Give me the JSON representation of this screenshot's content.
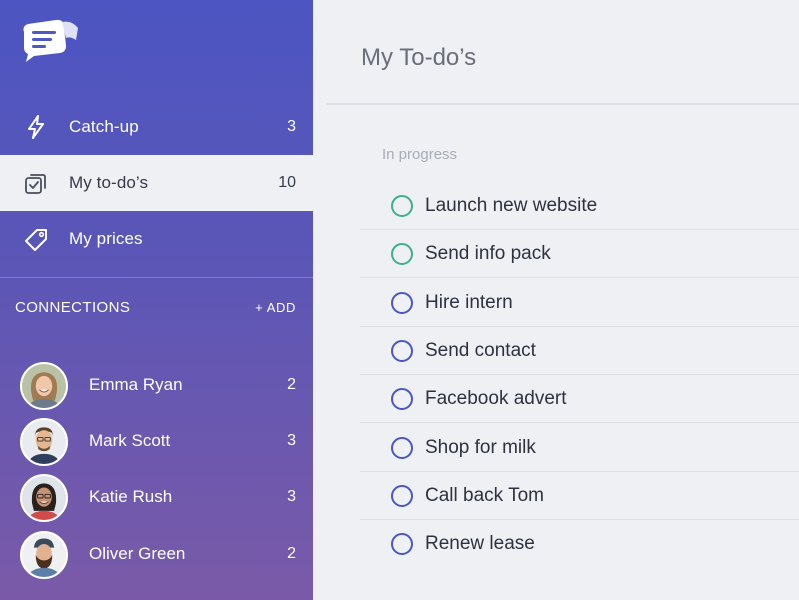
{
  "sidebar": {
    "nav": [
      {
        "label": "Catch-up",
        "count": "3",
        "icon": "lightning-icon"
      },
      {
        "label": "My to-do’s",
        "count": "10",
        "icon": "todo-check-icon"
      },
      {
        "label": "My prices",
        "count": "",
        "icon": "price-tag-icon"
      }
    ],
    "connections": {
      "header": "CONNECTIONS",
      "add_label": "+ ADD",
      "people": [
        {
          "name": "Emma Ryan",
          "count": "2"
        },
        {
          "name": "Mark Scott",
          "count": "3"
        },
        {
          "name": "Katie Rush",
          "count": "3"
        },
        {
          "name": "Oliver Green",
          "count": "2"
        }
      ]
    }
  },
  "main": {
    "title": "My To-do’s",
    "section": "In progress",
    "todos": [
      {
        "label": "Launch new website",
        "status_color": "#3fae8c"
      },
      {
        "label": "Send info pack",
        "status_color": "#3fae8c"
      },
      {
        "label": "Hire intern",
        "status_color": "#4a56c6"
      },
      {
        "label": "Send contact",
        "status_color": "#4a56c6"
      },
      {
        "label": "Facebook advert",
        "status_color": "#4a56c6"
      },
      {
        "label": "Shop for milk",
        "status_color": "#4a56c6"
      },
      {
        "label": "Call back Tom",
        "status_color": "#4a56c6"
      },
      {
        "label": "Renew lease",
        "status_color": "#4a56c6"
      }
    ]
  },
  "colors": {
    "sidebar_top": "#4c55c2",
    "sidebar_bottom": "#7a5aa8",
    "active_bg": "#eef0f4",
    "teal": "#3fae8c",
    "blue": "#4a56c6"
  }
}
